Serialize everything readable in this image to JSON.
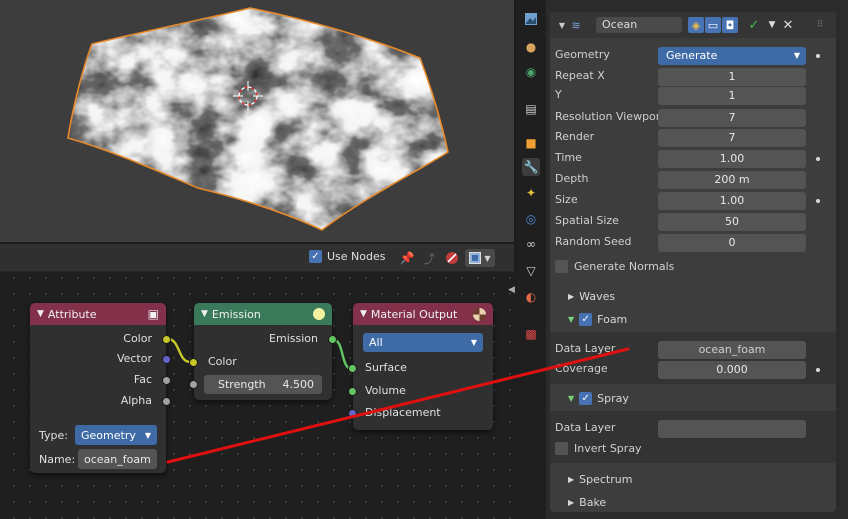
{
  "node_editor": {
    "use_nodes_label": "Use Nodes",
    "attribute_node": {
      "title": "Attribute",
      "outputs": [
        "Color",
        "Vector",
        "Fac",
        "Alpha"
      ],
      "type_label": "Type:",
      "type_value": "Geometry",
      "name_label": "Name:",
      "name_value": "ocean_foam"
    },
    "emission_node": {
      "title": "Emission",
      "output": "Emission",
      "color_input": "Color",
      "strength_label": "Strength",
      "strength_value": "4.500"
    },
    "material_output_node": {
      "title": "Material Output",
      "target": "All",
      "inputs": [
        "Surface",
        "Volume",
        "Displacement"
      ]
    }
  },
  "modifier": {
    "name": "Ocean",
    "geometry_label": "Geometry",
    "geometry_value": "Generate",
    "repeat_x_label": "Repeat X",
    "repeat_x_value": "1",
    "y_label": "Y",
    "y_value": "1",
    "resolution_viewport_label": "Resolution Viewpor",
    "resolution_viewport_value": "7",
    "render_label": "Render",
    "render_value": "7",
    "time_label": "Time",
    "time_value": "1.00",
    "depth_label": "Depth",
    "depth_value": "200 m",
    "size_label": "Size",
    "size_value": "1.00",
    "spatial_size_label": "Spatial Size",
    "spatial_size_value": "50",
    "random_seed_label": "Random Seed",
    "random_seed_value": "0",
    "generate_normals_label": "Generate Normals",
    "waves_label": "Waves",
    "foam": {
      "label": "Foam",
      "data_layer_label": "Data Layer",
      "data_layer_value": "ocean_foam",
      "coverage_label": "Coverage",
      "coverage_value": "0.000"
    },
    "spray": {
      "label": "Spray",
      "data_layer_label": "Data Layer",
      "data_layer_value": "",
      "invert_spray_label": "Invert Spray"
    },
    "spectrum_label": "Spectrum",
    "bake_label": "Bake"
  },
  "colors": {
    "accent": "#4772b3",
    "attribute_header": "#83314a",
    "emission_header": "#3a7a5a",
    "output_header": "#83314a",
    "selection_outline": "#e78a2b",
    "annotation_line": "#e01010"
  }
}
